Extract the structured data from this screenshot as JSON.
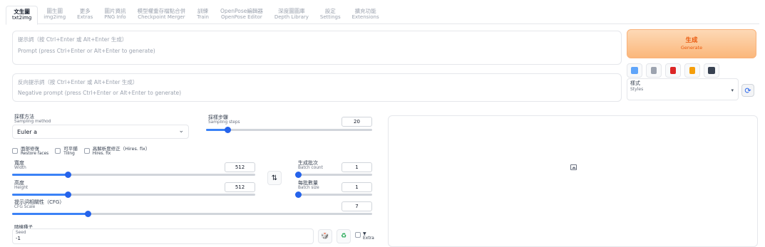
{
  "tabs": [
    {
      "zh": "文生圖",
      "en": "txt2img",
      "active": true
    },
    {
      "zh": "圖生圖",
      "en": "img2img"
    },
    {
      "zh": "更多",
      "en": "Extras"
    },
    {
      "zh": "圖片資訊",
      "en": "PNG Info"
    },
    {
      "zh": "模型權重存檔點合併",
      "en": "Checkpoint Merger"
    },
    {
      "zh": "訓練",
      "en": "Train"
    },
    {
      "zh": "OpenPose編輯器",
      "en": "OpenPose Editor"
    },
    {
      "zh": "深度圖圖庫",
      "en": "Depth Library"
    },
    {
      "zh": "設定",
      "en": "Settings"
    },
    {
      "zh": "擴充功能",
      "en": "Extensions"
    }
  ],
  "prompt": {
    "placeholder_zh": "提示詞（按 Ctrl+Enter 或 Alt+Enter 生成）",
    "placeholder_en": "Prompt (press Ctrl+Enter or Alt+Enter to generate)"
  },
  "negative_prompt": {
    "placeholder_zh": "反向提示詞（按 Ctrl+Enter 或 Alt+Enter 生成）",
    "placeholder_en": "Negative prompt (press Ctrl+Enter or Alt+Enter to generate)"
  },
  "generate": {
    "zh": "生成",
    "en": "Generate"
  },
  "tools": [
    "check-icon",
    "trash-icon",
    "card-icon",
    "clipboard-icon",
    "save-icon"
  ],
  "styles": {
    "zh": "樣式",
    "en": "Styles"
  },
  "sampling_method": {
    "zh": "採樣方法",
    "en": "Sampling method",
    "value": "Euler a"
  },
  "sampling_steps": {
    "zh": "採樣步驟",
    "en": "Sampling steps",
    "value": "20",
    "fraction": 0.13
  },
  "restore_faces": {
    "zh": "面部修復",
    "en": "Restore faces"
  },
  "tiling": {
    "zh": "可平鋪",
    "en": "Tiling"
  },
  "hires_fix": {
    "zh": "高解析度修正（Hires. fix）",
    "en": "Hires. fix"
  },
  "width": {
    "zh": "寬度",
    "en": "Width",
    "value": "512",
    "fraction": 0.23
  },
  "height": {
    "zh": "高度",
    "en": "Height",
    "value": "512",
    "fraction": 0.23
  },
  "batch_count": {
    "zh": "生成批次",
    "en": "Batch count",
    "value": "1",
    "fraction": 0.0
  },
  "batch_size": {
    "zh": "每批數量",
    "en": "Batch size",
    "value": "1",
    "fraction": 0.0
  },
  "cfg_scale": {
    "zh": "提示詞相關性（CFG）",
    "en": "CFG Scale",
    "value": "7",
    "fraction": 0.21
  },
  "seed": {
    "zh": "隨機種子",
    "en": "Seed",
    "value": "-1"
  },
  "extra": {
    "label": "Extra",
    "arrow": "▼"
  },
  "colors": {
    "accent": "#2563eb",
    "generate_text": "#ea580c"
  }
}
